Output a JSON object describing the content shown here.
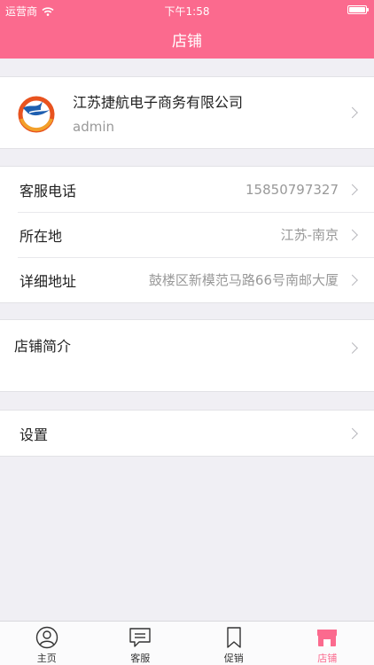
{
  "status_bar": {
    "carrier": "运营商",
    "time": "下午1:58"
  },
  "nav": {
    "title": "店铺"
  },
  "store": {
    "name": "江苏捷航电子商务有限公司",
    "admin": "admin"
  },
  "info_rows": [
    {
      "label": "客服电话",
      "value": "15850797327"
    },
    {
      "label": "所在地",
      "value": "江苏-南京"
    },
    {
      "label": "详细地址",
      "value": "鼓楼区新模范马路66号南邮大厦"
    }
  ],
  "intro": {
    "label": "店铺简介"
  },
  "settings": {
    "label": "设置"
  },
  "tabs": [
    {
      "label": "主页",
      "icon": "user-icon"
    },
    {
      "label": "客服",
      "icon": "chat-icon"
    },
    {
      "label": "促销",
      "icon": "bookmark-icon"
    },
    {
      "label": "店铺",
      "icon": "store-icon",
      "active": true
    }
  ],
  "colors": {
    "accent": "#fb6a8e",
    "background": "#f0eff4"
  }
}
